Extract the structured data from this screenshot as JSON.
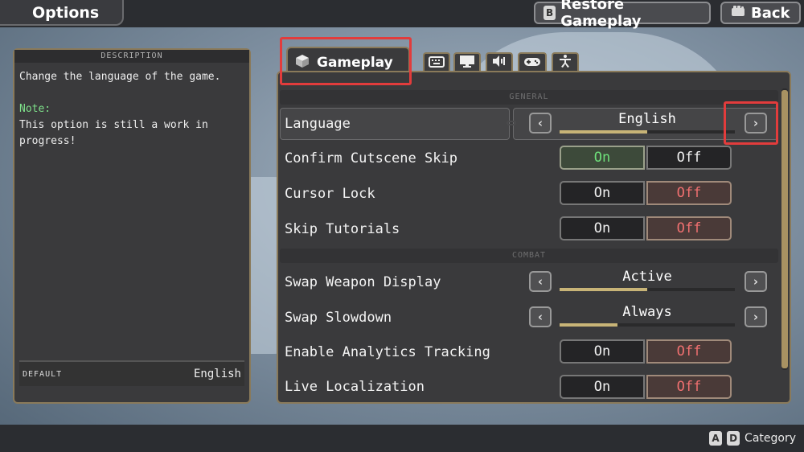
{
  "header": {
    "title": "Options",
    "restore_key": "B",
    "restore_label": "Restore Gameplay",
    "back_label": "Back"
  },
  "description": {
    "heading": "DESCRIPTION",
    "text": "Change the language of the game.",
    "note_label": "Note:",
    "note_text": "This option is still a work in progress!",
    "default_label": "DEFAULT",
    "default_value": "English"
  },
  "tabs": {
    "active_label": "Gameplay",
    "icons": [
      "keyboard-icon",
      "monitor-icon",
      "speaker-icon",
      "gamepad-icon",
      "accessibility-icon"
    ]
  },
  "sections": {
    "general": "GENERAL",
    "combat": "COMBAT"
  },
  "settings": {
    "language": {
      "label": "Language",
      "value": "English",
      "level": 0.5
    },
    "confirm_skip": {
      "label": "Confirm Cutscene Skip",
      "on": "On",
      "off": "Off",
      "selected": "On"
    },
    "cursor_lock": {
      "label": "Cursor Lock",
      "on": "On",
      "off": "Off",
      "selected": "Off"
    },
    "skip_tutorials": {
      "label": "Skip Tutorials",
      "on": "On",
      "off": "Off",
      "selected": "Off"
    },
    "swap_weapon": {
      "label": "Swap Weapon Display",
      "value": "Active",
      "level": 0.5
    },
    "swap_slowdown": {
      "label": "Swap Slowdown",
      "value": "Always",
      "level": 0.33
    },
    "analytics": {
      "label": "Enable Analytics Tracking",
      "on": "On",
      "off": "Off",
      "selected": "Off"
    },
    "live_loc": {
      "label": "Live Localization",
      "on": "On",
      "off": "Off",
      "selected": "Off"
    }
  },
  "footer": {
    "key_a": "A",
    "key_d": "D",
    "label": "Category"
  },
  "colors": {
    "accent_gold": "#c8b477",
    "on_green": "#6ee07a",
    "off_red": "#f07070",
    "highlight_red": "#e23c3c"
  }
}
